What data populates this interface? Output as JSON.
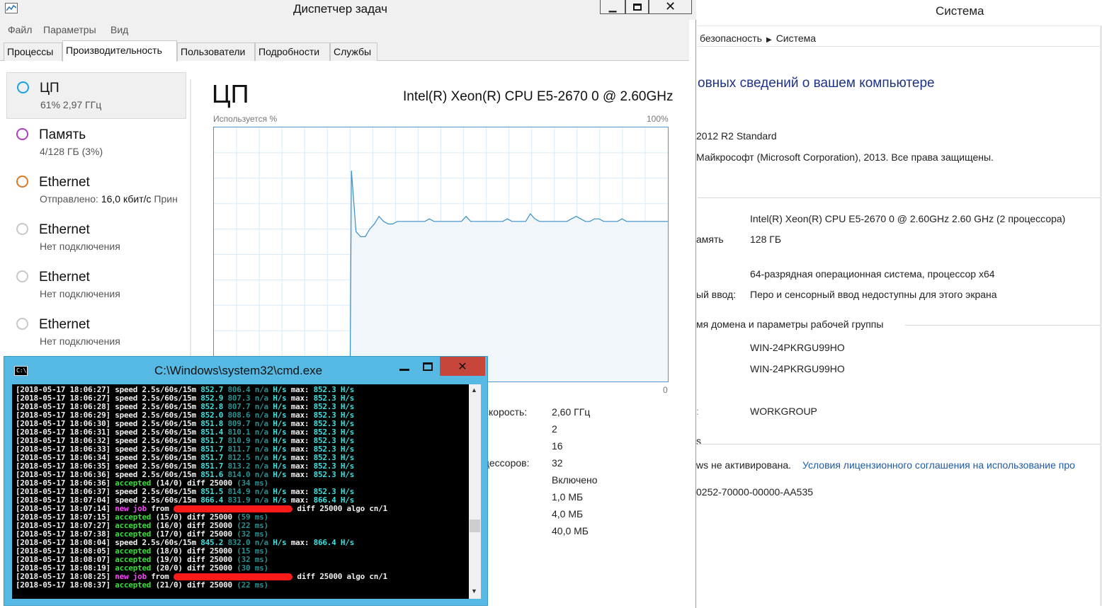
{
  "system": {
    "title": "Система",
    "breadcrumb": [
      "безопасность",
      "Система"
    ],
    "heading": "овных сведений о вашем компьютере",
    "edition": "2012 R2 Standard",
    "copyright": "Майкрософт (Microsoft Corporation), 2013. Все права защищены.",
    "cpu": "Intel(R) Xeon(R) CPU E5-2670 0 @ 2.60GHz   2.60 GHz  (2 процессора)",
    "ram_label": "амять",
    "ram": "128 ГБ",
    "systype": "64-разрядная операционная система, процессор x64",
    "pen_label": "ый ввод:",
    "pen": "Перо и сенсорный ввод недоступны для этого экрана",
    "domain_header": "мя домена и параметры рабочей группы",
    "computer_name": "WIN-24PKRGU99HO",
    "full_name": "WIN-24PKRGU99HO",
    "workgroup": "WORKGROUP",
    "s_label": "s",
    "activation": "ws не активирована.",
    "license_link": "Условия лицензионного соглашения на использование про",
    "product_id": "0252-70000-00000-AA535"
  },
  "taskmanager": {
    "title": "Диспетчер задач",
    "menu": [
      "Файл",
      "Параметры",
      "Вид"
    ],
    "tabs": [
      "Процессы",
      "Производительность",
      "Пользователи",
      "Подробности",
      "Службы"
    ],
    "resources": [
      {
        "name": "ЦП",
        "sub": "61%  2,97 ГГц",
        "color": "#1aa0e8"
      },
      {
        "name": "Память",
        "sub": "4/128 ГБ (3%)",
        "color": "#b03fc8"
      },
      {
        "name": "Ethernet",
        "sub": "Отправлено: ",
        "sub_value": "16,0 кбит/с",
        "sub_tail": "  Прин",
        "color": "#d87a28"
      },
      {
        "name": "Ethernet",
        "sub": "Нет подключения",
        "color": "#c8c8c8"
      },
      {
        "name": "Ethernet",
        "sub": "Нет подключения",
        "color": "#c8c8c8"
      },
      {
        "name": "Ethernet",
        "sub": "Нет подключения",
        "color": "#c8c8c8"
      }
    ],
    "cpu_title": "ЦП",
    "cpu_model": "Intel(R) Xeon(R) CPU E5-2670 0 @ 2.60GHz",
    "graph_label": "Используется %",
    "graph_max": "100%",
    "graph_min": "0",
    "graph_values": [
      0,
      0,
      0,
      0,
      0,
      0,
      0,
      0,
      0,
      0,
      0,
      0,
      0,
      0,
      0,
      0,
      0,
      0,
      0,
      0,
      0,
      0,
      0,
      0,
      0,
      0,
      0,
      0,
      0,
      0,
      83,
      59,
      57,
      57,
      60,
      62,
      65,
      63,
      62,
      62,
      63,
      63,
      63,
      63,
      63,
      63,
      63,
      64,
      63,
      63,
      63,
      63,
      63,
      63,
      63,
      65,
      63,
      63,
      63,
      63,
      63,
      63,
      63,
      63,
      64,
      63,
      63,
      63,
      63,
      66,
      64,
      63,
      63,
      63,
      63,
      63,
      63,
      63,
      64,
      65,
      64,
      63,
      63,
      64,
      64,
      63,
      63,
      63,
      63,
      64,
      63,
      63,
      63,
      63,
      63,
      63,
      63,
      63,
      63,
      63
    ],
    "stats": {
      "speed_label": "скорость:",
      "speed": "2,60 ГГц",
      "sockets": "2",
      "cores": "16",
      "lp_label": "цессоров:",
      "lp": "32",
      "virt": "Включено",
      "l1": "1,0 МБ",
      "l2": "4,0 МБ",
      "l3": "40,0 МБ"
    }
  },
  "cmd": {
    "title": "C:\\Windows\\system32\\cmd.exe",
    "lines": [
      {
        "t": "speed",
        "ts": "[2018-05-17 18:06:27]",
        "a": "852.7",
        "b": "806.4",
        "max": "852.3"
      },
      {
        "t": "speed",
        "ts": "[2018-05-17 18:06:27]",
        "a": "852.9",
        "b": "807.3",
        "max": "852.3"
      },
      {
        "t": "speed",
        "ts": "[2018-05-17 18:06:28]",
        "a": "852.8",
        "b": "807.7",
        "max": "852.3"
      },
      {
        "t": "speed",
        "ts": "[2018-05-17 18:06:29]",
        "a": "852.0",
        "b": "808.6",
        "max": "852.3"
      },
      {
        "t": "speed",
        "ts": "[2018-05-17 18:06:30]",
        "a": "851.8",
        "b": "809.7",
        "max": "852.3"
      },
      {
        "t": "speed",
        "ts": "[2018-05-17 18:06:31]",
        "a": "851.4",
        "b": "810.1",
        "max": "852.3"
      },
      {
        "t": "speed",
        "ts": "[2018-05-17 18:06:32]",
        "a": "851.7",
        "b": "810.9",
        "max": "852.3"
      },
      {
        "t": "speed",
        "ts": "[2018-05-17 18:06:33]",
        "a": "851.7",
        "b": "811.7",
        "max": "852.3"
      },
      {
        "t": "speed",
        "ts": "[2018-05-17 18:06:34]",
        "a": "851.7",
        "b": "812.5",
        "max": "852.3"
      },
      {
        "t": "speed",
        "ts": "[2018-05-17 18:06:35]",
        "a": "851.7",
        "b": "813.2",
        "max": "852.3"
      },
      {
        "t": "speed",
        "ts": "[2018-05-17 18:06:36]",
        "a": "851.6",
        "b": "814.0",
        "max": "852.3"
      },
      {
        "t": "acc",
        "ts": "[2018-05-17 18:06:36]",
        "n": "(14/0)",
        "diff": "25000",
        "ms": "(34 ms)"
      },
      {
        "t": "speed",
        "ts": "[2018-05-17 18:06:37]",
        "a": "851.5",
        "b": "814.9",
        "max": "852.3"
      },
      {
        "t": "speed",
        "ts": "[2018-05-17 18:07:04]",
        "a": "866.4",
        "b": "831.9",
        "max": "866.4"
      },
      {
        "t": "job",
        "ts": "[2018-05-17 18:07:14]",
        "diff": "25000",
        "algo": "cn/1"
      },
      {
        "t": "acc",
        "ts": "[2018-05-17 18:07:15]",
        "n": "(15/0)",
        "diff": "25000",
        "ms": "(59 ms)"
      },
      {
        "t": "acc",
        "ts": "[2018-05-17 18:07:27]",
        "n": "(16/0)",
        "diff": "25000",
        "ms": "(22 ms)"
      },
      {
        "t": "acc",
        "ts": "[2018-05-17 18:07:38]",
        "n": "(17/0)",
        "diff": "25000",
        "ms": "(32 ms)"
      },
      {
        "t": "speed",
        "ts": "[2018-05-17 18:08:04]",
        "a": "845.2",
        "b": "832.0",
        "max": "866.4"
      },
      {
        "t": "acc",
        "ts": "[2018-05-17 18:08:05]",
        "n": "(18/0)",
        "diff": "25000",
        "ms": "(15 ms)"
      },
      {
        "t": "acc",
        "ts": "[2018-05-17 18:08:07]",
        "n": "(19/0)",
        "diff": "25000",
        "ms": "(32 ms)"
      },
      {
        "t": "acc",
        "ts": "[2018-05-17 18:08:19]",
        "n": "(20/0)",
        "diff": "25000",
        "ms": "(30 ms)"
      },
      {
        "t": "job",
        "ts": "[2018-05-17 18:08:25]",
        "diff": "25000",
        "algo": "cn/1"
      },
      {
        "t": "acc",
        "ts": "[2018-05-17 18:08:37]",
        "n": "(21/0)",
        "diff": "25000",
        "ms": "(22 ms)"
      }
    ],
    "words": {
      "speed": "speed",
      "window": "2.5s/60s/15m",
      "na": "n/a",
      "hs": "H/s",
      "max": "max:",
      "accepted": "accepted",
      "diff": "diff",
      "new": "new",
      "job": "job",
      "from": "from",
      "algo": "algo"
    }
  }
}
